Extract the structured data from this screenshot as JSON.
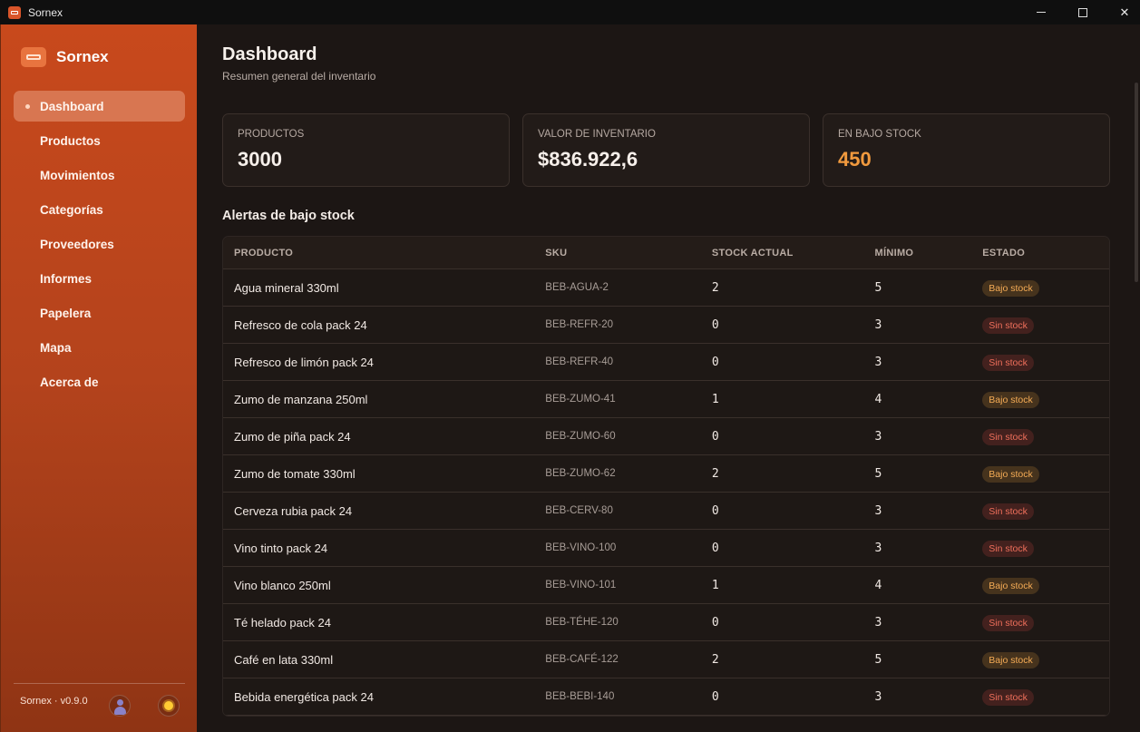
{
  "window": {
    "title": "Sornex"
  },
  "sidebar": {
    "brand": "Sornex",
    "items": [
      {
        "label": "Dashboard",
        "active": true
      },
      {
        "label": "Productos"
      },
      {
        "label": "Movimientos"
      },
      {
        "label": "Categorías"
      },
      {
        "label": "Proveedores"
      },
      {
        "label": "Informes"
      },
      {
        "label": "Papelera"
      },
      {
        "label": "Mapa"
      },
      {
        "label": "Acerca de"
      }
    ],
    "version": "Sornex · v0.9.0"
  },
  "header": {
    "title": "Dashboard",
    "subtitle": "Resumen general del inventario"
  },
  "cards": [
    {
      "label": "PRODUCTOS",
      "value": "3000"
    },
    {
      "label": "VALOR DE INVENTARIO",
      "value": "$836.922,6"
    },
    {
      "label": "EN BAJO STOCK",
      "value": "450"
    }
  ],
  "alerts": {
    "title": "Alertas de bajo stock",
    "columns": [
      "PRODUCTO",
      "SKU",
      "STOCK ACTUAL",
      "MÍNIMO",
      "ESTADO"
    ],
    "rows": [
      {
        "name": "Agua mineral 330ml",
        "sku": "BEB-AGUA-2",
        "stock": "2",
        "min": "5",
        "status": "Bajo stock"
      },
      {
        "name": "Refresco de cola pack 24",
        "sku": "BEB-REFR-20",
        "stock": "0",
        "min": "3",
        "status": "Sin stock"
      },
      {
        "name": "Refresco de limón pack 24",
        "sku": "BEB-REFR-40",
        "stock": "0",
        "min": "3",
        "status": "Sin stock"
      },
      {
        "name": "Zumo de manzana 250ml",
        "sku": "BEB-ZUMO-41",
        "stock": "1",
        "min": "4",
        "status": "Bajo stock"
      },
      {
        "name": "Zumo de piña pack 24",
        "sku": "BEB-ZUMO-60",
        "stock": "0",
        "min": "3",
        "status": "Sin stock"
      },
      {
        "name": "Zumo de tomate 330ml",
        "sku": "BEB-ZUMO-62",
        "stock": "2",
        "min": "5",
        "status": "Bajo stock"
      },
      {
        "name": "Cerveza rubia pack 24",
        "sku": "BEB-CERV-80",
        "stock": "0",
        "min": "3",
        "status": "Sin stock"
      },
      {
        "name": "Vino tinto pack 24",
        "sku": "BEB-VINO-100",
        "stock": "0",
        "min": "3",
        "status": "Sin stock"
      },
      {
        "name": "Vino blanco 250ml",
        "sku": "BEB-VINO-101",
        "stock": "1",
        "min": "4",
        "status": "Bajo stock"
      },
      {
        "name": "Té helado pack 24",
        "sku": "BEB-TÉHE-120",
        "stock": "0",
        "min": "3",
        "status": "Sin stock"
      },
      {
        "name": "Café en lata 330ml",
        "sku": "BEB-CAFÉ-122",
        "stock": "2",
        "min": "5",
        "status": "Bajo stock"
      },
      {
        "name": "Bebida energética pack 24",
        "sku": "BEB-BEBI-140",
        "stock": "0",
        "min": "3",
        "status": "Sin stock"
      }
    ]
  },
  "colors": {
    "accent": "#c8491c",
    "warning": "#f19a3e",
    "danger": "#ef6f5b"
  },
  "icons": [
    "app-logo-icon",
    "minimize-icon",
    "maximize-icon",
    "close-icon",
    "user-avatar-icon",
    "sun-theme-icon"
  ]
}
